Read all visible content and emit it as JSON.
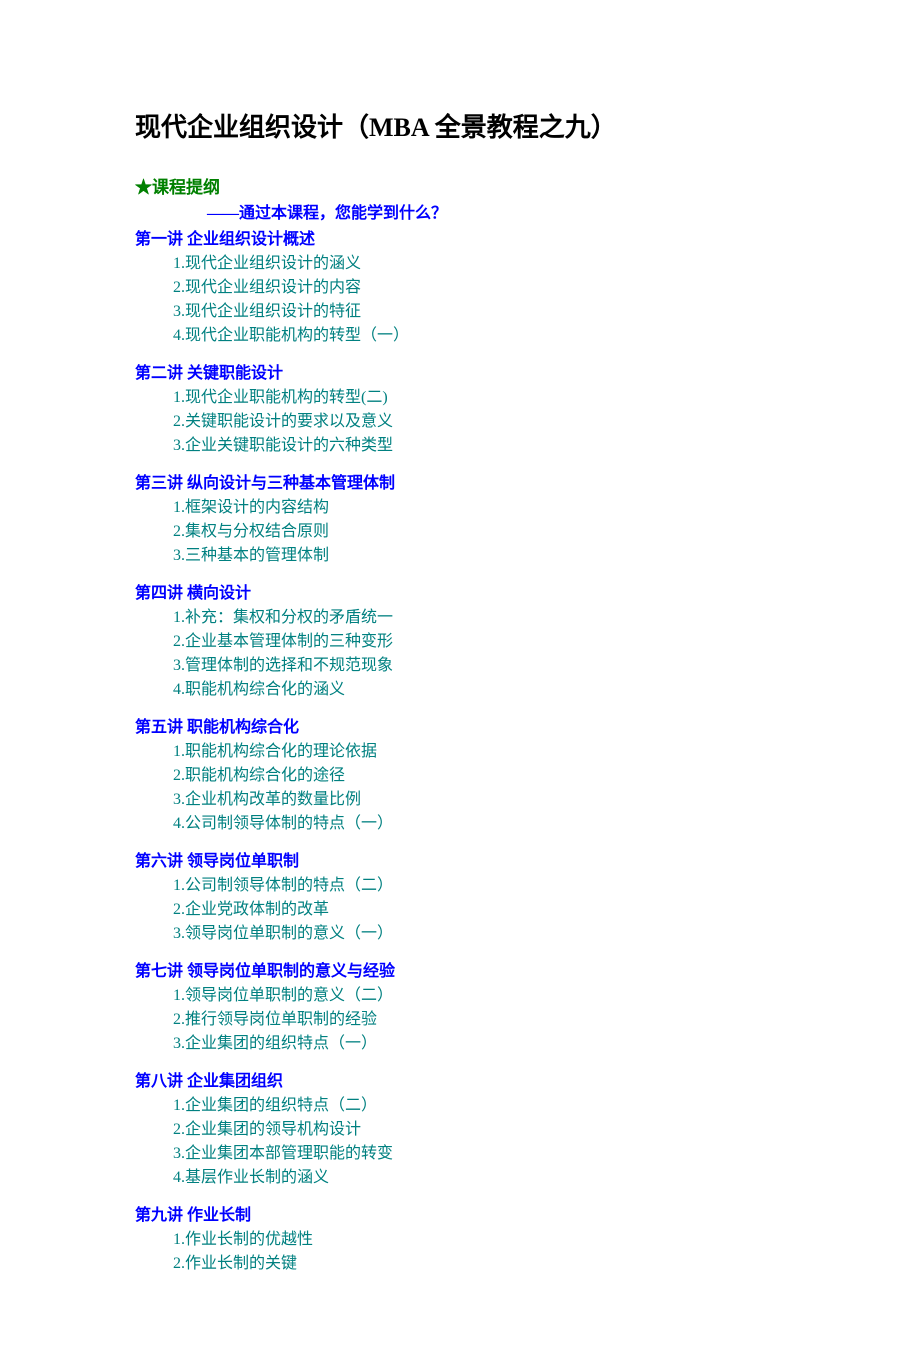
{
  "title": "现代企业组织设计（MBA 全景教程之九）",
  "star": "★",
  "outline_label": "课程提纲",
  "subtitle": "——通过本课程，您能学到什么？",
  "lectures": [
    {
      "title": "第一讲   企业组织设计概述",
      "items": [
        "1.现代企业组织设计的涵义",
        "2.现代企业组织设计的内容",
        "3.现代企业组织设计的特征",
        "4.现代企业职能机构的转型（一）"
      ]
    },
    {
      "title": "第二讲   关键职能设计",
      "items": [
        "1.现代企业职能机构的转型(二)",
        "2.关键职能设计的要求以及意义",
        "3.企业关键职能设计的六种类型"
      ]
    },
    {
      "title": "第三讲   纵向设计与三种基本管理体制",
      "items": [
        "1.框架设计的内容结构",
        "2.集权与分权结合原则",
        "3.三种基本的管理体制"
      ]
    },
    {
      "title": "第四讲   横向设计",
      "items": [
        "1.补充：集权和分权的矛盾统一",
        "2.企业基本管理体制的三种变形",
        "3.管理体制的选择和不规范现象",
        "4.职能机构综合化的涵义"
      ]
    },
    {
      "title": "第五讲   职能机构综合化",
      "items": [
        "1.职能机构综合化的理论依据",
        "2.职能机构综合化的途径",
        "3.企业机构改革的数量比例",
        "4.公司制领导体制的特点（一）"
      ]
    },
    {
      "title": "第六讲   领导岗位单职制",
      "items": [
        "1.公司制领导体制的特点（二）",
        "2.企业党政体制的改革",
        "3.领导岗位单职制的意义（一）"
      ]
    },
    {
      "title": "第七讲   领导岗位单职制的意义与经验",
      "items": [
        "1.领导岗位单职制的意义（二）",
        "2.推行领导岗位单职制的经验",
        "3.企业集团的组织特点（一）"
      ]
    },
    {
      "title": "第八讲   企业集团组织",
      "items": [
        "1.企业集团的组织特点（二）",
        "2.企业集团的领导机构设计",
        "3.企业集团本部管理职能的转变",
        "4.基层作业长制的涵义"
      ]
    },
    {
      "title": "第九讲   作业长制",
      "items": [
        "1.作业长制的优越性",
        "2.作业长制的关键"
      ]
    }
  ]
}
